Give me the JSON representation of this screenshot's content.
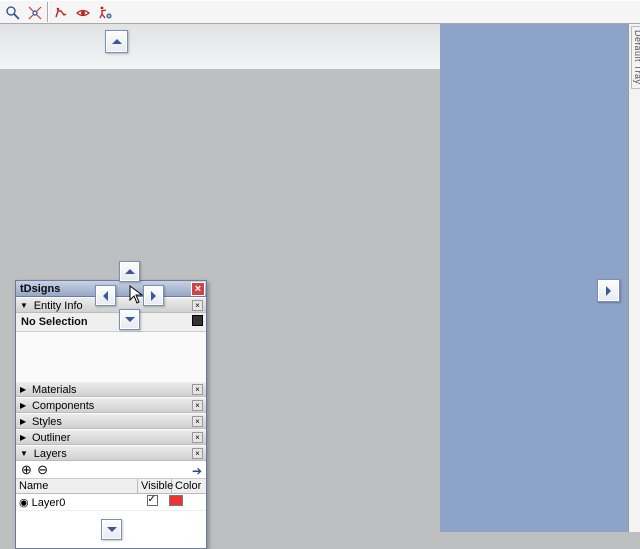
{
  "toolbar": {
    "icons": [
      "zoom-icon",
      "zoom-extents-icon",
      "walk-icon",
      "look-around-icon",
      "position-camera-icon"
    ]
  },
  "right_tray_label": "Default Tray",
  "panel": {
    "title": "tDsigns",
    "entity_info": {
      "header": "Entity Info",
      "no_selection": "No Selection"
    },
    "sections": [
      "Materials",
      "Components",
      "Styles",
      "Outliner"
    ],
    "layers": {
      "header": "Layers",
      "cols": {
        "name": "Name",
        "visible": "Visible",
        "color": "Color"
      },
      "rows": [
        {
          "name": "Layer0",
          "visible": true,
          "color": "#e33",
          "active": true
        }
      ]
    }
  }
}
